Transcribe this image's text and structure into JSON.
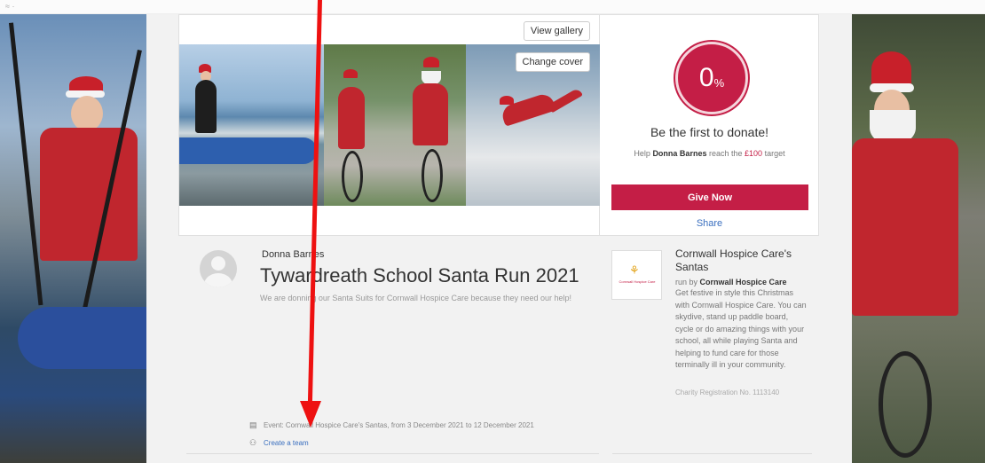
{
  "cover": {
    "view_gallery": "View gallery",
    "change_cover": "Change cover"
  },
  "donation": {
    "progress_value": "0",
    "progress_unit": "%",
    "progress_fraction": 0,
    "cta_heading": "Be the first to donate!",
    "help_prefix": "Help",
    "fundraiser_name": "Donna Barnes",
    "help_middle": "reach the",
    "target_amount": "£100",
    "help_suffix": "target",
    "give_button": "Give Now",
    "share_link": "Share"
  },
  "fundraiser": {
    "author": "Donna Barnes",
    "title": "Tywardreath School Santa Run 2021",
    "story": "We are donning our Santa Suits for Cornwall Hospice Care because they need our help!",
    "event_text": "Event: Cornwall Hospice Care's Santas, from 3 December 2021 to 12 December 2021",
    "create_team": "Create a team"
  },
  "charity": {
    "logo_text": "Cornwall Hospice Care",
    "name": "Cornwall Hospice Care's Santas",
    "run_by_prefix": "run by",
    "run_by": "Cornwall Hospice Care",
    "description": "Get festive in style this Christmas with Cornwall Hospice Care. You can skydive, stand up paddle board, cycle or do amazing things with your school, all while playing Santa and helping to fund care for those terminally ill in your community.",
    "registration": "Charity Registration No. 1113140"
  },
  "colors": {
    "accent": "#c41e46",
    "link": "#3a6fbf",
    "annotation_arrow": "#ee1111"
  },
  "icons": {
    "event": "calendar-icon",
    "team": "team-icon"
  }
}
